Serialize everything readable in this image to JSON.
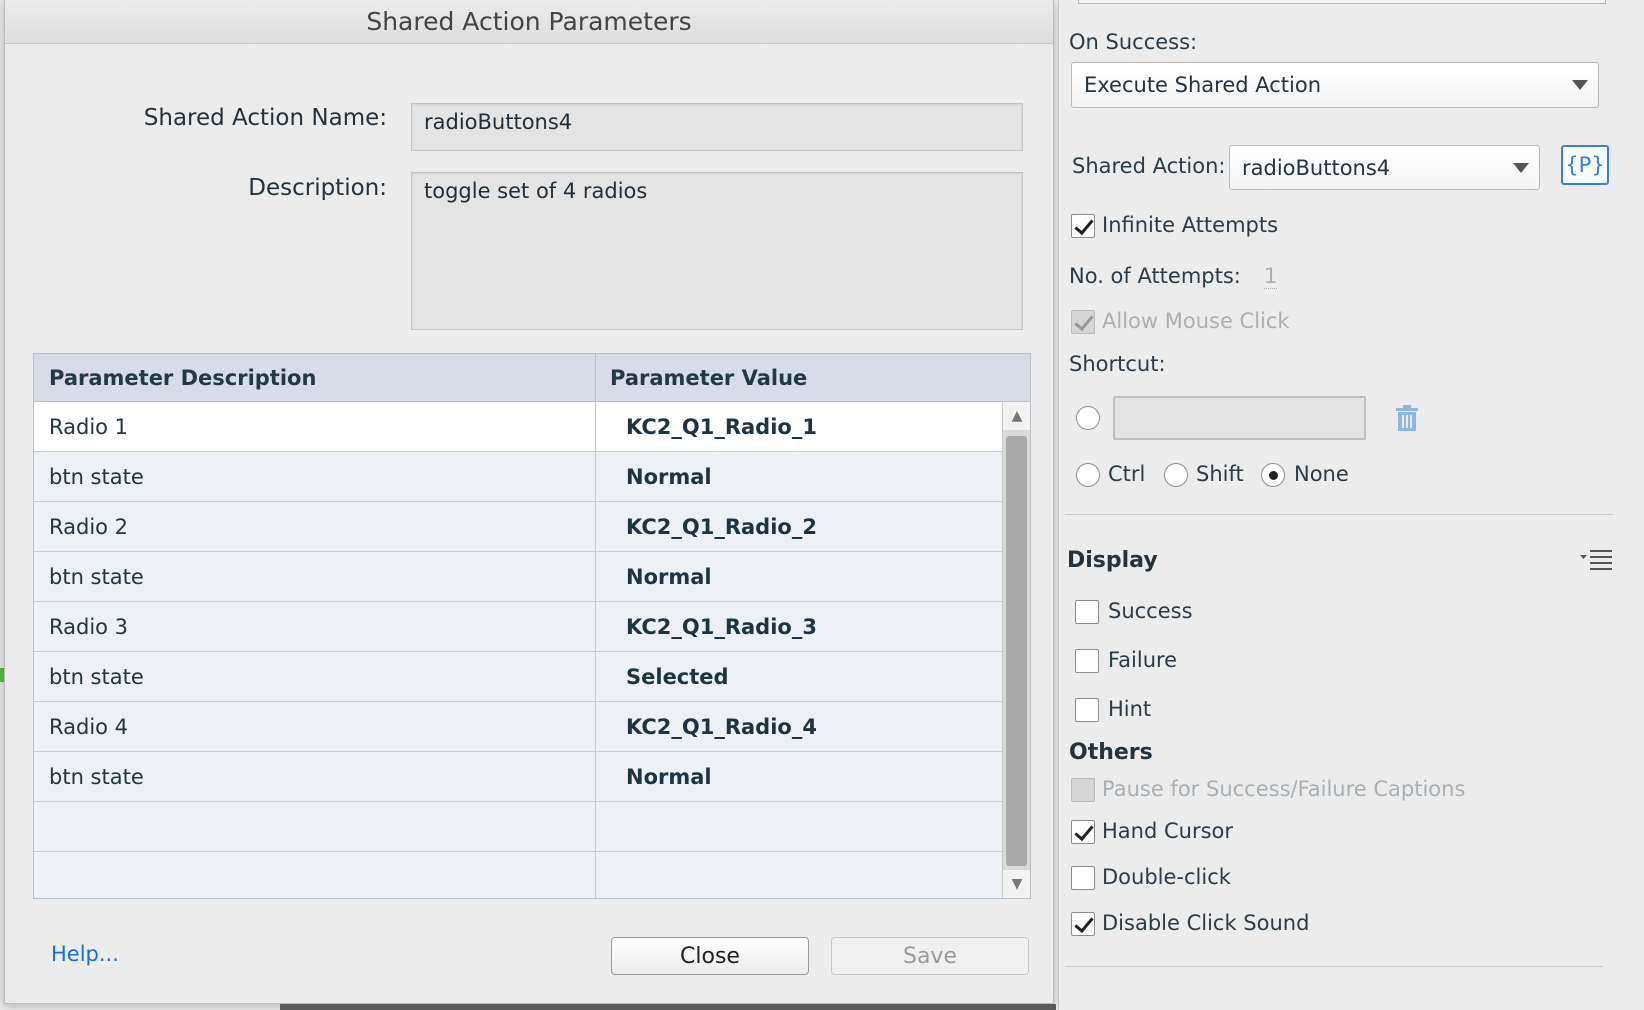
{
  "dialog": {
    "title": "Shared Action Parameters",
    "name_label": "Shared Action Name:",
    "name_value": "radioButtons4",
    "description_label": "Description:",
    "description_value": "toggle set of 4 radios",
    "table": {
      "headers": [
        "Parameter Description",
        "Parameter Value"
      ],
      "rows": [
        {
          "desc": "Radio 1",
          "value": "KC2_Q1_Radio_1"
        },
        {
          "desc": "btn state",
          "value": "Normal"
        },
        {
          "desc": "Radio 2",
          "value": "KC2_Q1_Radio_2"
        },
        {
          "desc": "btn state",
          "value": "Normal"
        },
        {
          "desc": "Radio 3",
          "value": "KC2_Q1_Radio_3"
        },
        {
          "desc": "btn state",
          "value": "Selected"
        },
        {
          "desc": "Radio 4",
          "value": "KC2_Q1_Radio_4"
        },
        {
          "desc": "btn state",
          "value": "Normal"
        },
        {
          "desc": "",
          "value": ""
        },
        {
          "desc": "",
          "value": ""
        }
      ]
    },
    "help_label": "Help...",
    "close_label": "Close",
    "save_label": "Save"
  },
  "panel": {
    "on_success_label": "On Success:",
    "on_success_value": "Execute Shared Action",
    "shared_action_label": "Shared Action:",
    "shared_action_value": "radioButtons4",
    "param_button_label": "{P}",
    "infinite_attempts_label": "Infinite Attempts",
    "attempts_label": "No. of Attempts:",
    "attempts_value": "1",
    "allow_mouse_click_label": "Allow Mouse Click",
    "shortcut_label": "Shortcut:",
    "modifiers": {
      "ctrl": "Ctrl",
      "shift": "Shift",
      "none": "None"
    },
    "display_title": "Display",
    "display_items": {
      "success": "Success",
      "failure": "Failure",
      "hint": "Hint"
    },
    "others_title": "Others",
    "others_items": {
      "pause": "Pause for Success/Failure Captions",
      "hand_cursor": "Hand Cursor",
      "double_click": "Double-click",
      "disable_click_sound": "Disable Click Sound"
    }
  },
  "colors": {
    "accent": "#3d7fd0",
    "link": "#1a6fd0",
    "header_bg": "#d7dce6"
  },
  "icons": [
    "trash-icon",
    "menu-options-icon",
    "checkmark-icon",
    "dropdown-caret-icon"
  ]
}
